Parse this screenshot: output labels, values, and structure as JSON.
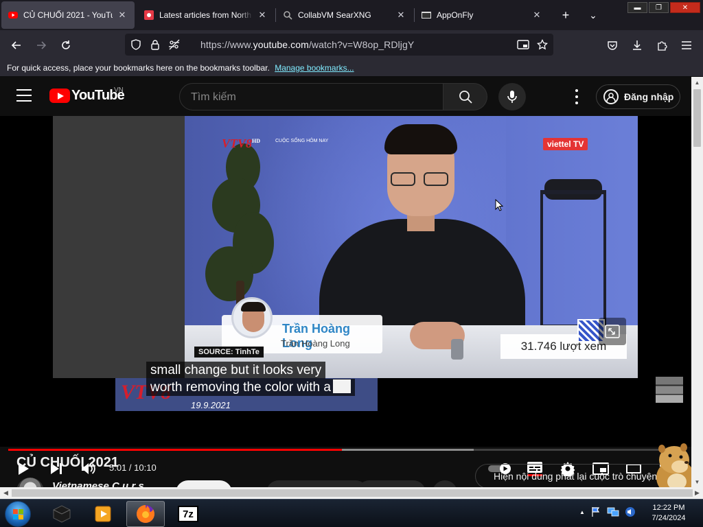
{
  "browser": {
    "tabs": [
      {
        "title": "CỦ CHUỐI 2021 - YouTube",
        "active": true
      },
      {
        "title": "Latest articles from North K",
        "active": false
      },
      {
        "title": "CollabVM SearXNG",
        "active": false
      },
      {
        "title": "AppOnFly",
        "active": false
      }
    ],
    "url_prefix": "https://www.",
    "url_host": "youtube.com",
    "url_path": "/watch?v=W8op_RDljgY",
    "bookmarks_text": "For quick access, place your bookmarks here on the bookmarks toolbar.",
    "bookmarks_link": "Manage bookmarks..."
  },
  "youtube": {
    "logo_text": "YouTube",
    "country_code": "VN",
    "search_placeholder": "Tìm kiếm",
    "sign_in_label": "Đăng nhập"
  },
  "video": {
    "overlay": {
      "channel_logo": "VTV8",
      "channel_logo_sup": "HD",
      "program_tag": "CUỘC SỐNG HÔM NAY",
      "broadcaster_badge": "viettel TV",
      "guest_name_main": "Trần Hoàng Long",
      "guest_name_sub": "Trần Hoàng Long",
      "source_label": "SOURCE: TinhTe",
      "views_overlay": "31.746 lượt xem",
      "bottom_logo": "VTV8",
      "bottom_date": "19.9.2021"
    },
    "captions": [
      "small change but it looks very",
      "worth removing the color with a"
    ],
    "time_current": "5:01",
    "time_total": "10:10",
    "time_display": "5:01 / 10:10",
    "progress_played": 0.494,
    "progress_buffered": 0.69
  },
  "below_player": {
    "title": "CỦ CHUỐI 2021",
    "channel_name": "Vietnamese C u r s",
    "replay_chip": "Hiện nội dung phát lại cuộc trò chuyện"
  },
  "taskbar": {
    "apps": [
      "media-player",
      "media-center",
      "firefox",
      "7-zip"
    ],
    "zip_label": "7z",
    "clock_time": "12:22 PM",
    "clock_date": "7/24/2024"
  },
  "colors": {
    "yt_red": "#ff0000",
    "firefox_tab_active": "#42414d",
    "link_blue": "#80ebff"
  }
}
